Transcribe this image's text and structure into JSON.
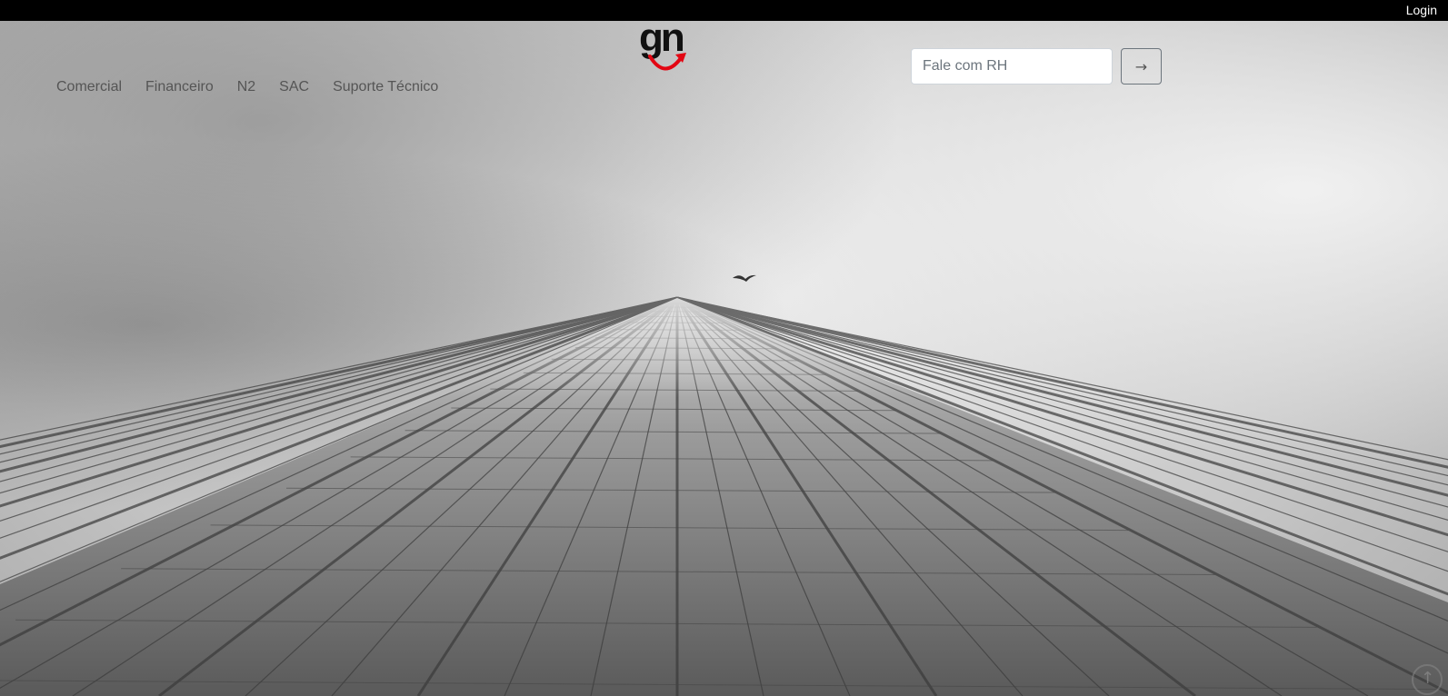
{
  "topbar": {
    "login_label": "Login"
  },
  "nav": {
    "items": [
      {
        "label": "Comercial"
      },
      {
        "label": "Financeiro"
      },
      {
        "label": "N2"
      },
      {
        "label": "SAC"
      },
      {
        "label": "Suporte Técnico"
      }
    ]
  },
  "logo": {
    "text": "gn",
    "accent_color": "#e30613",
    "icon": "smile-arrow-icon"
  },
  "search": {
    "placeholder": "Fale com RH",
    "value": "",
    "submit_label": "→"
  },
  "hero": {
    "image": "skyscraper-grayscale-photo"
  },
  "scroll_top": {
    "icon": "arrow-up-circle-icon",
    "glyph": "↑"
  }
}
